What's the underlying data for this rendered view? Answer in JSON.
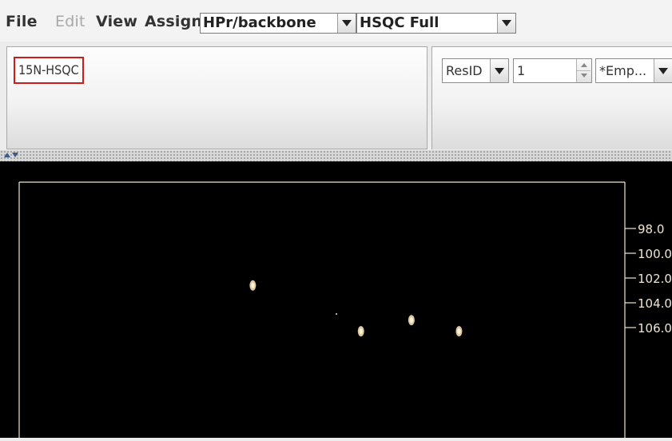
{
  "menubar": {
    "items": [
      {
        "label": "File",
        "enabled": true
      },
      {
        "label": "Edit",
        "enabled": false
      },
      {
        "label": "View",
        "enabled": true
      },
      {
        "label": "Assign",
        "enabled": true
      }
    ],
    "project_combo": {
      "value": "HPr/backbone"
    },
    "spectrum_combo": {
      "value": "HSQC Full"
    }
  },
  "spectrum_panel": {
    "label": "15N-HSQC",
    "highlight_color": "#d11a1a"
  },
  "navigator": {
    "field_select": "ResID",
    "residue_value": "1",
    "type_select": "*Emp..."
  },
  "plot": {
    "background": "#000000",
    "contour_color": "#f5deb3",
    "axis_color": "#f0e6d0",
    "axis_ticks": [
      "98.0",
      "100.0",
      "102.0",
      "104.0",
      "106.0"
    ],
    "peaks": [
      {
        "x": 8.38,
        "y": 102.6
      },
      {
        "x": 7.28,
        "y": 105.4
      },
      {
        "x": 7.63,
        "y": 106.3
      },
      {
        "x": 6.95,
        "y": 106.3
      }
    ],
    "noise": [
      {
        "x": 7.8,
        "y": 104.9
      }
    ],
    "axis_range": {
      "x": [
        10.0,
        5.8
      ],
      "y": [
        96.6,
        108.0
      ]
    }
  }
}
